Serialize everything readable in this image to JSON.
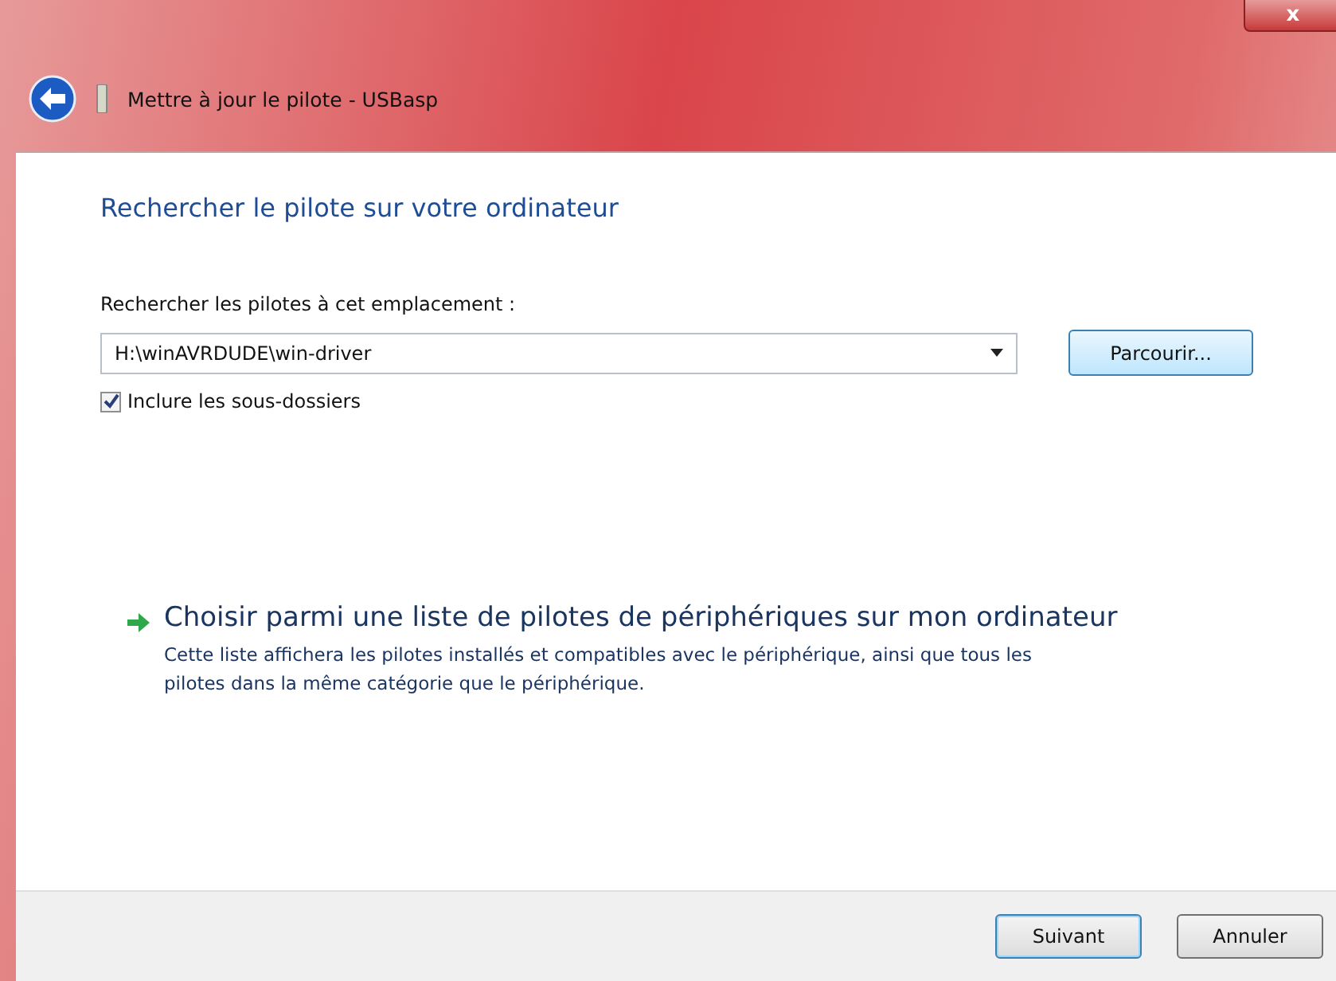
{
  "window": {
    "title": "Mettre à jour le pilote - USBasp",
    "close_label": "x"
  },
  "heading": "Rechercher le pilote sur votre ordinateur",
  "location": {
    "label": "Rechercher les pilotes à cet emplacement :",
    "value": "H:\\winAVRDUDE\\win-driver",
    "browse": "Parcourir..."
  },
  "include_subfolders": {
    "label": "Inclure les sous-dossiers",
    "checked": true
  },
  "option": {
    "title": "Choisir parmi une liste de pilotes de périphériques sur mon ordinateur",
    "description": "Cette liste affichera les pilotes installés et compatibles avec le périphérique, ainsi que tous les pilotes dans la même catégorie que le périphérique."
  },
  "buttons": [
    {
      "label": "Suivant",
      "default": true
    },
    {
      "label": "Annuler",
      "default": false
    }
  ]
}
